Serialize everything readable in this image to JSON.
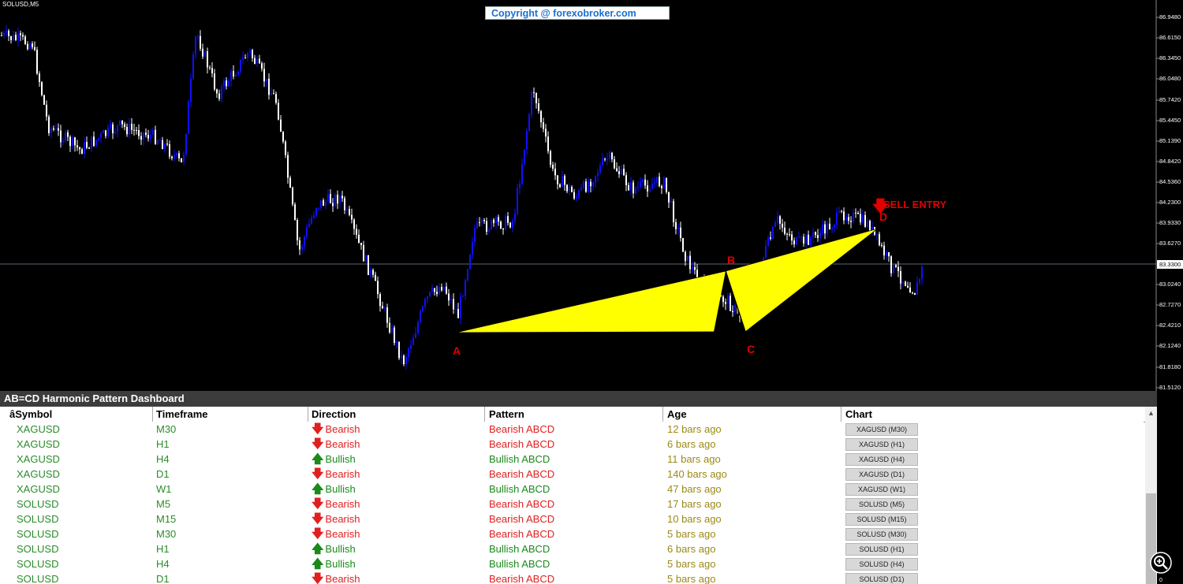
{
  "chart": {
    "symbol_label": "SOLUSD,M5",
    "copyright": "Copyright @ forexobroker.com",
    "points": {
      "A": "A",
      "B": "B",
      "C": "C",
      "D": "D"
    },
    "sell_label": "SELL ENTRY",
    "current_price": "83.3300",
    "price_ticks": [
      "86.9480",
      "86.6150",
      "86.3450",
      "86.0480",
      "85.7420",
      "85.4450",
      "85.1390",
      "84.8420",
      "84.5360",
      "84.2300",
      "83.9330",
      "83.6270",
      "83.3300",
      "83.0240",
      "82.7270",
      "82.4210",
      "82.1240",
      "81.8180",
      "81.5120"
    ],
    "colors": {
      "bull_candle": "#1010ff",
      "bear_candle": "#ffffff",
      "pattern_fill": "#ffff00",
      "labels": "#e00000"
    }
  },
  "dashboard": {
    "title": "AB=CD Harmonic Pattern Dashboard",
    "columns": [
      "âSymbol",
      "Timeframe",
      "Direction",
      "Pattern",
      "Age",
      "Chart"
    ],
    "rows": [
      {
        "symbol": "XAGUSD",
        "timeframe": "M30",
        "direction": "Bearish",
        "pattern": "Bearish ABCD",
        "age": "12 bars ago",
        "chart": "XAGUSD (M30)"
      },
      {
        "symbol": "XAGUSD",
        "timeframe": "H1",
        "direction": "Bearish",
        "pattern": "Bearish ABCD",
        "age": "6 bars ago",
        "chart": "XAGUSD (H1)"
      },
      {
        "symbol": "XAGUSD",
        "timeframe": "H4",
        "direction": "Bullish",
        "pattern": "Bullish ABCD",
        "age": "11 bars ago",
        "chart": "XAGUSD (H4)"
      },
      {
        "symbol": "XAGUSD",
        "timeframe": "D1",
        "direction": "Bearish",
        "pattern": "Bearish ABCD",
        "age": "140 bars ago",
        "chart": "XAGUSD (D1)"
      },
      {
        "symbol": "XAGUSD",
        "timeframe": "W1",
        "direction": "Bullish",
        "pattern": "Bullish ABCD",
        "age": "47 bars ago",
        "chart": "XAGUSD (W1)"
      },
      {
        "symbol": "SOLUSD",
        "timeframe": "M5",
        "direction": "Bearish",
        "pattern": "Bearish ABCD",
        "age": "17 bars ago",
        "chart": "SOLUSD (M5)"
      },
      {
        "symbol": "SOLUSD",
        "timeframe": "M15",
        "direction": "Bearish",
        "pattern": "Bearish ABCD",
        "age": "10 bars ago",
        "chart": "SOLUSD (M15)"
      },
      {
        "symbol": "SOLUSD",
        "timeframe": "M30",
        "direction": "Bearish",
        "pattern": "Bearish ABCD",
        "age": "5 bars ago",
        "chart": "SOLUSD (M30)"
      },
      {
        "symbol": "SOLUSD",
        "timeframe": "H1",
        "direction": "Bullish",
        "pattern": "Bullish ABCD",
        "age": "6 bars ago",
        "chart": "SOLUSD (H1)"
      },
      {
        "symbol": "SOLUSD",
        "timeframe": "H4",
        "direction": "Bullish",
        "pattern": "Bullish ABCD",
        "age": "5 bars ago",
        "chart": "SOLUSD (H4)"
      },
      {
        "symbol": "SOLUSD",
        "timeframe": "D1",
        "direction": "Bearish",
        "pattern": "Bearish ABCD",
        "age": "5 bars ago",
        "chart": "SOLUSD (D1)"
      }
    ],
    "colors": {
      "bearish": "#e02020",
      "bullish": "#1a8a1a",
      "symbol": "#2a8c2a",
      "age": "#9a8a16"
    },
    "icons": {
      "bearish": "arrow-down-icon",
      "bullish": "arrow-up-icon"
    }
  },
  "corner_label": "0"
}
